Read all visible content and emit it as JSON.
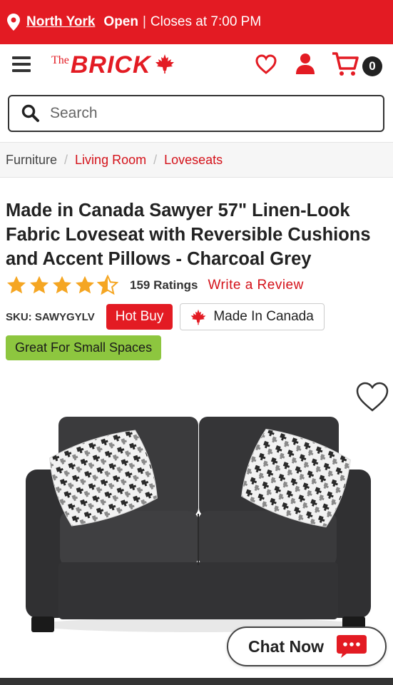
{
  "topbar": {
    "store": "North York",
    "open": "Open",
    "separator": "|",
    "closes": "Closes at 7:00 PM"
  },
  "header": {
    "logo_the": "The",
    "logo_brick": "BRICK",
    "cart_count": "0"
  },
  "search": {
    "placeholder": "Search"
  },
  "breadcrumb": {
    "items": [
      "Furniture",
      "Living Room",
      "Loveseats"
    ],
    "separator": "/"
  },
  "product": {
    "title": "Made in Canada Sawyer 57\" Linen-Look Fabric Loveseat with Reversible Cushions and Accent Pillows - Charcoal Grey",
    "rating": 4.5,
    "ratings_count": "159 Ratings",
    "write_review": "Write a Review",
    "sku": "SKU: SAWYGYLV",
    "hot_buy": "Hot Buy",
    "made_in_canada": "Made In Canada",
    "tag": "Great For Small Spaces"
  },
  "chat": {
    "label": "Chat Now"
  },
  "colors": {
    "brand_red": "#e31b23",
    "star_orange": "#f5a623",
    "tag_green": "#8dc63f"
  },
  "icons": [
    "map-pin-icon",
    "hamburger-icon",
    "maple-leaf-icon",
    "heart-icon",
    "user-icon",
    "cart-icon",
    "search-icon",
    "star-icon",
    "chat-bubble-icon"
  ]
}
